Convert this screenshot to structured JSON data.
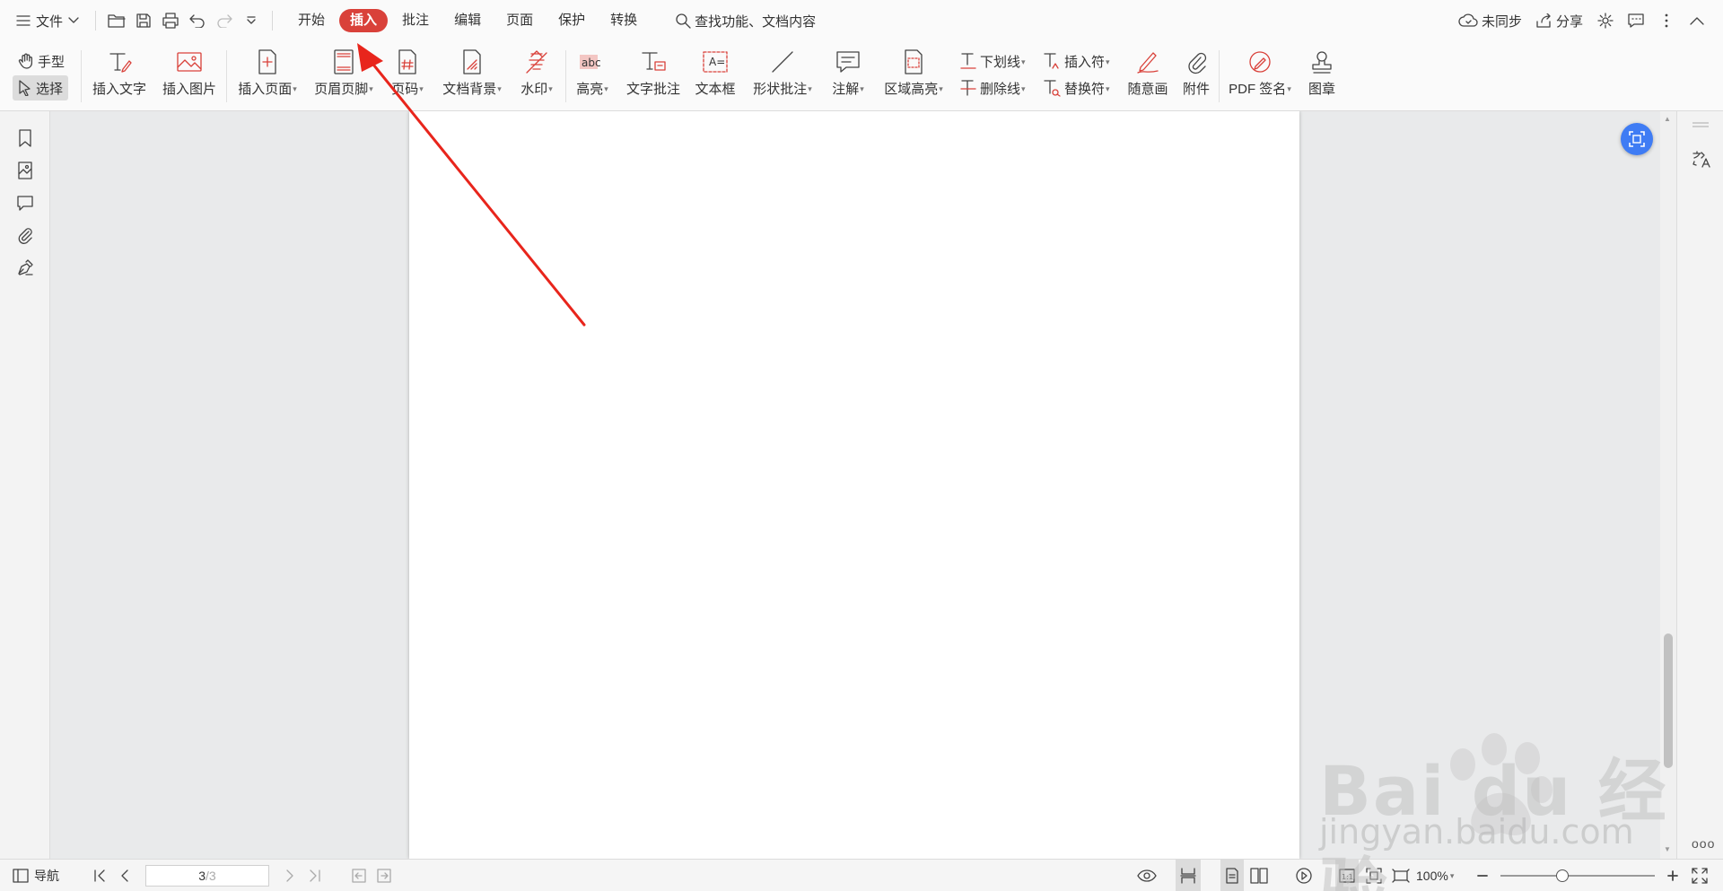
{
  "titlebar": {
    "file_menu": "文件",
    "tabs": [
      {
        "label": "开始",
        "active": false
      },
      {
        "label": "插入",
        "active": true
      },
      {
        "label": "批注",
        "active": false
      },
      {
        "label": "编辑",
        "active": false
      },
      {
        "label": "页面",
        "active": false
      },
      {
        "label": "保护",
        "active": false
      },
      {
        "label": "转换",
        "active": false
      }
    ],
    "search_label": "查找功能、文档内容",
    "sync_label": "未同步",
    "share_label": "分享"
  },
  "ribbon": {
    "hand_tool": "手型",
    "select_tool": "选择",
    "insert_text": "插入文字",
    "insert_image": "插入图片",
    "insert_page": "插入页面",
    "header_footer": "页眉页脚",
    "page_number": "页码",
    "doc_background": "文档背景",
    "watermark": "水印",
    "highlight": "高亮",
    "text_annotation": "文字批注",
    "text_box": "文本框",
    "shape_annotation": "形状批注",
    "note": "注解",
    "area_highlight": "区域高亮",
    "underline": "下划线",
    "strikethrough": "删除线",
    "insert_mark": "插入符",
    "replace_mark": "替换符",
    "freehand": "随意画",
    "attachment": "附件",
    "pdf_sign": "PDF 签名",
    "stamp": "图章"
  },
  "statusbar": {
    "nav_label": "导航",
    "current_page": "3",
    "total_pages": "/3",
    "zoom": "100%",
    "zoom_fraction": 0.4
  },
  "watermark": {
    "brand": "Bai du 经验",
    "url": "jingyan.baidu.com"
  },
  "colors": {
    "accent": "#d9413a",
    "float_button": "#3f7cf4"
  }
}
